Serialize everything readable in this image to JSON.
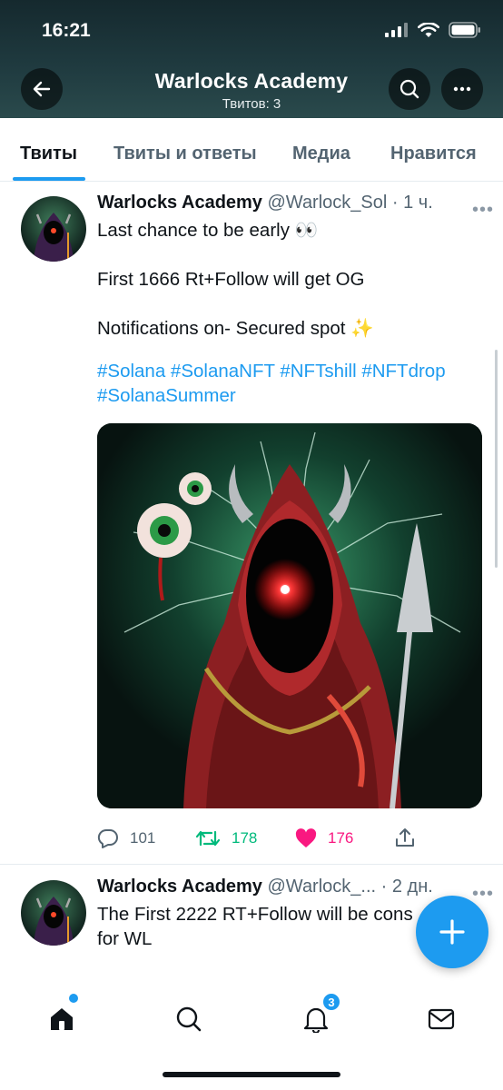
{
  "status_bar": {
    "time": "16:21"
  },
  "header": {
    "title": "Warlocks Academy",
    "subtitle": "Твитов: 3",
    "back_icon": "arrow-left-icon",
    "search_icon": "search-icon",
    "more_icon": "more-horizontal-icon"
  },
  "tabs": [
    {
      "label": "Твиты",
      "active": true
    },
    {
      "label": "Твиты и ответы",
      "active": false
    },
    {
      "label": "Медиа",
      "active": false
    },
    {
      "label": "Нравится",
      "active": false
    }
  ],
  "tweets": [
    {
      "name": "Warlocks Academy",
      "handle": "@Warlock_Sol",
      "time": "· 1 ч.",
      "text": "Last chance to be early 👀\n\nFirst 1666 Rt+Follow will get OG\n\nNotifications on- Secured spot ✨",
      "hashtags": "#Solana #SolanaNFT #NFTshill #NFTdrop #SolanaSummer",
      "replies": "101",
      "retweets": "178",
      "likes": "176",
      "liked": true
    },
    {
      "name": "Warlocks Academy",
      "handle": "@Warlock_...",
      "time": "· 2 дн.",
      "text": "The First 2222 RT+Follow will be cons\nfor WL"
    }
  ],
  "bottom_nav": {
    "items": [
      "home-icon",
      "search-icon",
      "notifications-icon",
      "messages-icon"
    ],
    "notification_count": "3"
  },
  "colors": {
    "accent": "#1d9bf0",
    "retweet": "#00ba7c",
    "like": "#f91880",
    "header_bg": "#1f3a3f"
  }
}
